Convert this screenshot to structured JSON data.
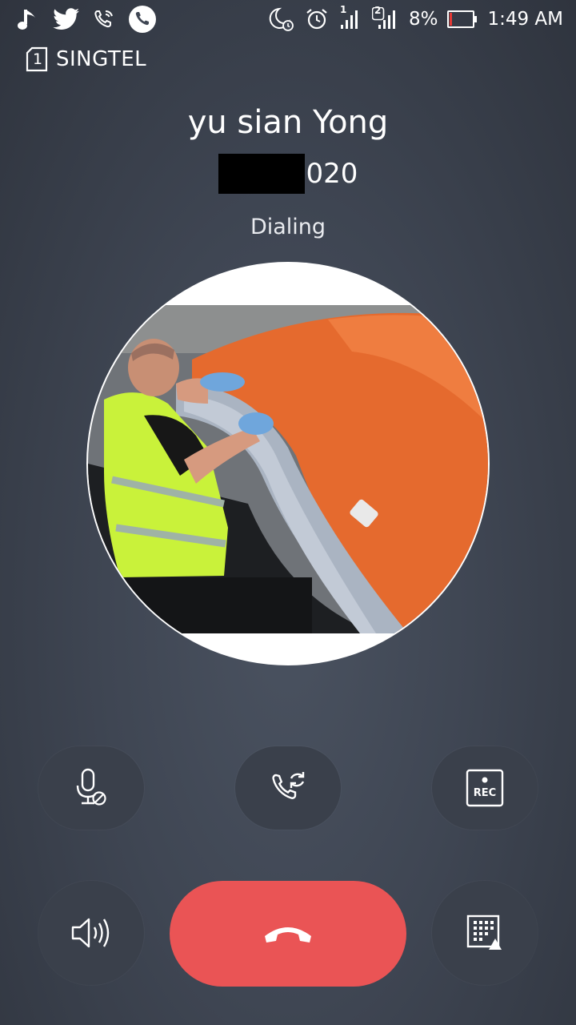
{
  "status_bar": {
    "battery": "8%",
    "time": "1:49 AM",
    "sim1_label": "1",
    "sim2_label": "2",
    "icons": [
      "music-note-icon",
      "twitter-icon",
      "wifi-calling-icon",
      "phone-icon",
      "moon-icon",
      "alarm-icon",
      "signal-sim1-icon",
      "signal-sim2-icon",
      "battery-icon"
    ]
  },
  "carrier": {
    "sim_number": "1",
    "name": "SINGTEL"
  },
  "contact": {
    "name": "yu sian Yong",
    "phone_suffix": "020",
    "status": "Dialing"
  },
  "controls": {
    "rec_label": "REC",
    "buttons": [
      "mute-button",
      "switch-call-button",
      "record-button",
      "speaker-button",
      "end-call-button",
      "keypad-button"
    ]
  },
  "colors": {
    "end_call": "#ea5455",
    "control_bg": "#3a404b",
    "background": "#3f4653",
    "battery_low": "#e53935"
  }
}
